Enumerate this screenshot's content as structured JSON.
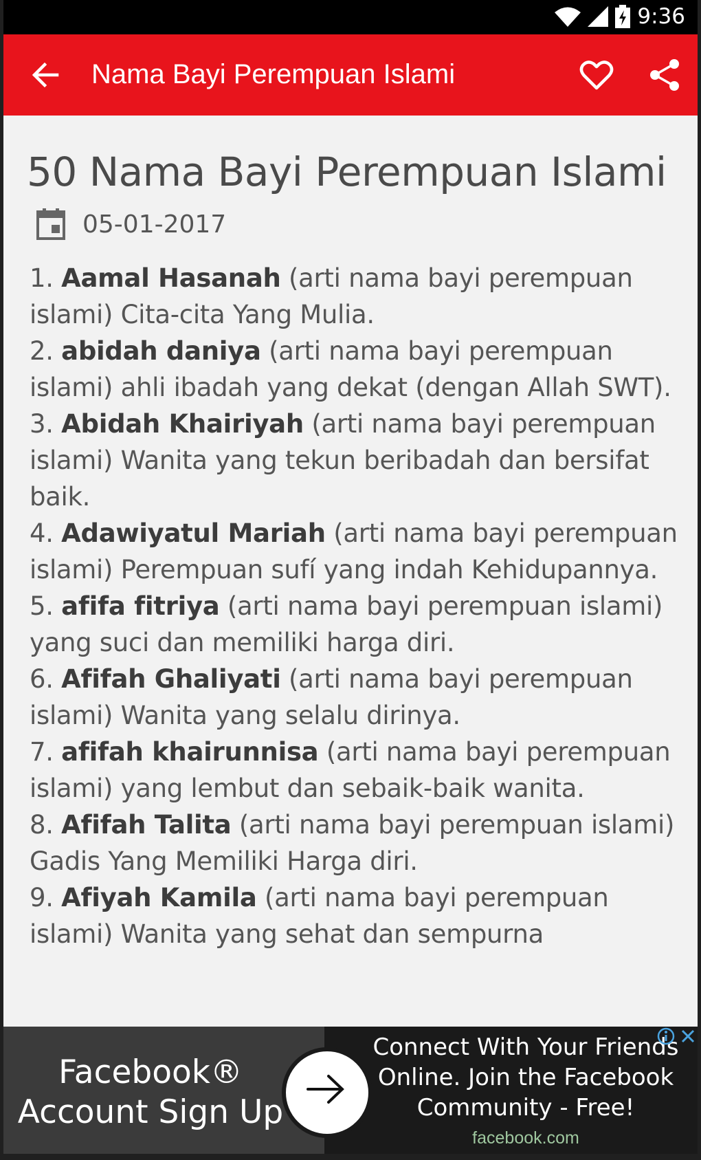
{
  "status_bar": {
    "time": "9:36",
    "icons": [
      "wifi-icon",
      "signal-icon",
      "battery-icon"
    ]
  },
  "app_bar": {
    "title": "Nama Bayi Perempuan Islami",
    "icons": [
      "back-arrow-icon",
      "heart-icon",
      "share-icon"
    ],
    "color": "#e8141c"
  },
  "article": {
    "title": "50 Nama Bayi Perempuan Islami",
    "date": "05-01-2017",
    "entries": [
      {
        "num": "1.",
        "name": "Aamal Hasanah",
        "text": "(arti nama bayi perempuan islami) Cita-cita Yang Mulia."
      },
      {
        "num": "2.",
        "name": "abidah daniya",
        "text": "(arti nama bayi perempuan islami) ahli ibadah yang dekat (dengan Allah SWT)."
      },
      {
        "num": "3.",
        "name": "Abidah Khairiyah",
        "text": "(arti nama bayi perempuan islami) Wanita yang tekun beribadah dan bersifat baik."
      },
      {
        "num": "4.",
        "name": "Adawiyatul Mariah",
        "text": "(arti nama bayi perempuan islami) Perempuan sufí yang indah Kehidupannya."
      },
      {
        "num": "5.",
        "name": "afifa fitriya",
        "text": "(arti nama bayi perempuan islami) yang suci dan memiliki harga diri."
      },
      {
        "num": "6.",
        "name": "Afifah Ghaliyati",
        "text": "(arti nama bayi perempuan islami) Wanita yang selalu dirinya."
      },
      {
        "num": "7.",
        "name": "afifah khairunnisa",
        "text": "(arti nama bayi perempuan islami) yang lembut dan sebaik-baik wanita."
      },
      {
        "num": "8.",
        "name": "Afifah Talita",
        "text": "(arti nama bayi perempuan islami) Gadis Yang Memiliki Harga diri."
      },
      {
        "num": "9.",
        "name": "Afiyah Kamila",
        "text": "(arti nama bayi perempuan islami) Wanita yang sehat dan sempurna"
      }
    ]
  },
  "ad": {
    "headline_line1": "Facebook®",
    "headline_line2": "Account Sign Up",
    "body_line1": "Connect With Your Friends",
    "body_line2": "Online. Join the Facebook",
    "body_line3": "Community - Free!",
    "domain": "facebook.com"
  }
}
